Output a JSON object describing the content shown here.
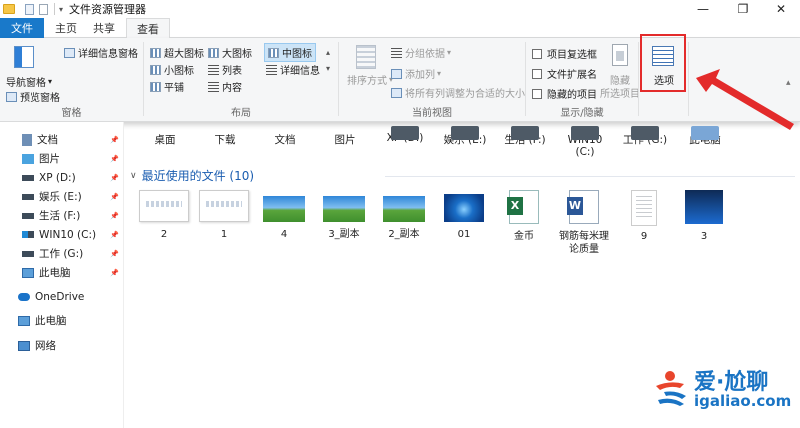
{
  "window": {
    "title": "文件资源管理器",
    "controls": {
      "minimize": "—",
      "maximize": "❐",
      "close": "✕"
    }
  },
  "tabs": [
    {
      "label": "文件",
      "active": false
    },
    {
      "label": "主页",
      "active": false
    },
    {
      "label": "共享",
      "active": false
    },
    {
      "label": "查看",
      "active": true
    }
  ],
  "ribbon": {
    "pane": {
      "label": "窗格",
      "navigation_pane": "导航窗格",
      "preview_pane": "预览窗格",
      "details_pane": "详细信息窗格"
    },
    "layout": {
      "label": "布局",
      "items": [
        "超大图标",
        "大图标",
        "中图标",
        "小图标",
        "列表",
        "详细信息",
        "平铺",
        "内容"
      ],
      "selected": "中图标"
    },
    "current_view": {
      "label": "当前视图",
      "sort_by": "排序方式",
      "group_by": "分组依据",
      "add_columns": "添加列",
      "size_all_columns": "将所有列调整为合适的大小"
    },
    "show_hide": {
      "label": "显示/隐藏",
      "item_checkboxes": "项目复选框",
      "file_extensions": "文件扩展名",
      "hidden_items": "隐藏的项目",
      "hide_selected": "隐藏",
      "hide_selected_sub": "所选项目"
    },
    "options": {
      "label": "选项"
    }
  },
  "navigation": {
    "items": [
      {
        "label": "文档",
        "pinned": true
      },
      {
        "label": "图片",
        "pinned": true
      },
      {
        "label": "XP (D:)",
        "pinned": true
      },
      {
        "label": "娱乐 (E:)",
        "pinned": true
      },
      {
        "label": "生活 (F:)",
        "pinned": true
      },
      {
        "label": "WIN10 (C:)",
        "pinned": true
      },
      {
        "label": "工作 (G:)",
        "pinned": true
      },
      {
        "label": "此电脑",
        "pinned": true
      }
    ],
    "roots": [
      {
        "label": "OneDrive"
      },
      {
        "label": "此电脑"
      },
      {
        "label": "网络"
      }
    ],
    "pin_glyph": "📌"
  },
  "quick_folders": [
    "桌面",
    "下载",
    "文档",
    "图片",
    "XP (D:)",
    "娱乐 (E:)",
    "生活 (F:)",
    "WIN10 (C:)",
    "工作 (G:)",
    "此电脑"
  ],
  "recent": {
    "header": "最近使用的文件 (10)",
    "files": [
      {
        "label": "2",
        "kind": "doc"
      },
      {
        "label": "1",
        "kind": "doc"
      },
      {
        "label": "4",
        "kind": "landscape"
      },
      {
        "label": "3_副本",
        "kind": "landscape"
      },
      {
        "label": "2_副本",
        "kind": "landscape"
      },
      {
        "label": "01",
        "kind": "win7"
      },
      {
        "label": "金币",
        "kind": "excel"
      },
      {
        "label": "钢筋每米理论质量",
        "kind": "word"
      },
      {
        "label": "9",
        "kind": "page"
      },
      {
        "label": "3",
        "kind": "dark"
      }
    ]
  },
  "watermark": {
    "brand": "爱·尬聊",
    "url": "igaliao.com"
  },
  "colors": {
    "accent": "#1979ca",
    "highlight_box": "#e32b2b",
    "link_blue": "#1a5db0"
  }
}
